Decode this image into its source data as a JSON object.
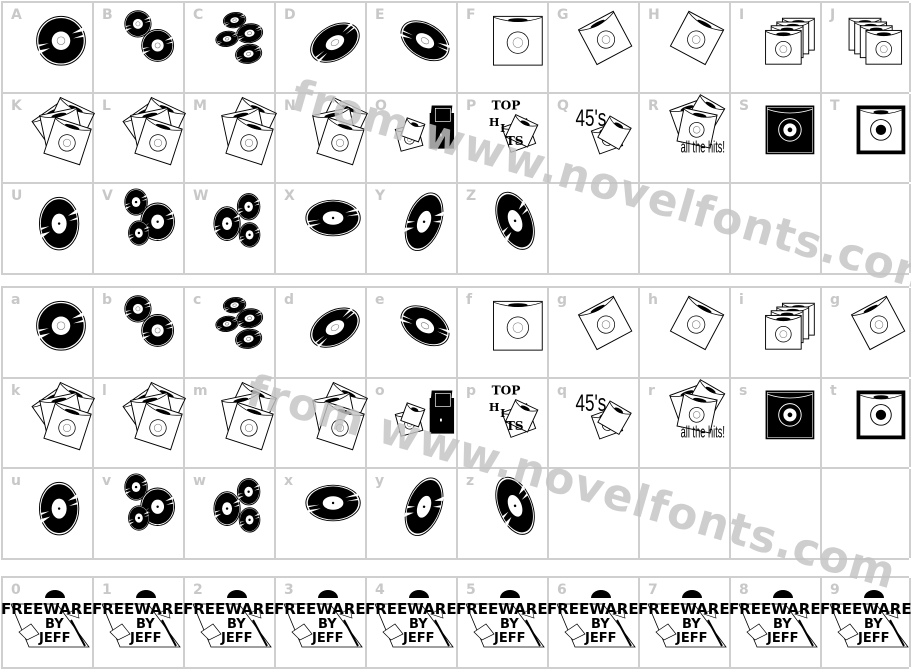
{
  "page": {
    "watermark_text": "from www.novelfonts.com"
  },
  "sections": [
    {
      "name": "uppercase",
      "rows": [
        [
          {
            "label": "A",
            "glyph": "record-round"
          },
          {
            "label": "B",
            "glyph": "two-records"
          },
          {
            "label": "C",
            "glyph": "four-records"
          },
          {
            "label": "D",
            "glyph": "record-tilt-right"
          },
          {
            "label": "E",
            "glyph": "record-tilt-left"
          },
          {
            "label": "F",
            "glyph": "sleeve-square"
          },
          {
            "label": "G",
            "glyph": "sleeve-rotated-left"
          },
          {
            "label": "H",
            "glyph": "sleeve-rotated-right"
          },
          {
            "label": "I",
            "glyph": "sleeve-stack-left"
          },
          {
            "label": "J",
            "glyph": "sleeve-stack-right"
          }
        ],
        [
          {
            "label": "K",
            "glyph": "sleeve-pile"
          },
          {
            "label": "L",
            "glyph": "sleeve-pile"
          },
          {
            "label": "M",
            "glyph": "sleeve-pile-two"
          },
          {
            "label": "N",
            "glyph": "sleeve-pile-two"
          },
          {
            "label": "O",
            "glyph": "record-box"
          },
          {
            "label": "P",
            "glyph": "top-hits"
          },
          {
            "label": "Q",
            "glyph": "45s"
          },
          {
            "label": "R",
            "glyph": "all-the-hits"
          },
          {
            "label": "S",
            "glyph": "framed-record-dark"
          },
          {
            "label": "T",
            "glyph": "framed-record-light"
          }
        ],
        [
          {
            "label": "U",
            "glyph": "record-oval-vertical"
          },
          {
            "label": "V",
            "glyph": "three-records-v"
          },
          {
            "label": "W",
            "glyph": "three-records-w"
          },
          {
            "label": "X",
            "glyph": "record-flat"
          },
          {
            "label": "Y",
            "glyph": "record-oval-tilt-right"
          },
          {
            "label": "Z",
            "glyph": "record-oval-tilt-left"
          },
          {
            "label": "",
            "glyph": ""
          },
          {
            "label": "",
            "glyph": ""
          },
          {
            "label": "",
            "glyph": ""
          },
          {
            "label": "",
            "glyph": ""
          }
        ]
      ]
    },
    {
      "name": "lowercase",
      "rows": [
        [
          {
            "label": "a",
            "glyph": "record-round"
          },
          {
            "label": "b",
            "glyph": "two-records"
          },
          {
            "label": "c",
            "glyph": "four-records"
          },
          {
            "label": "d",
            "glyph": "record-tilt-right"
          },
          {
            "label": "e",
            "glyph": "record-tilt-left"
          },
          {
            "label": "f",
            "glyph": "sleeve-square"
          },
          {
            "label": "g",
            "glyph": "sleeve-rotated-left"
          },
          {
            "label": "h",
            "glyph": "sleeve-rotated-right"
          },
          {
            "label": "i",
            "glyph": "sleeve-stack-left"
          },
          {
            "label": "g",
            "glyph": "sleeve-rotated-left"
          }
        ],
        [
          {
            "label": "k",
            "glyph": "sleeve-pile"
          },
          {
            "label": "l",
            "glyph": "sleeve-pile"
          },
          {
            "label": "m",
            "glyph": "sleeve-pile-two"
          },
          {
            "label": "",
            "glyph": "sleeve-pile-two"
          },
          {
            "label": "o",
            "glyph": "record-box"
          },
          {
            "label": "p",
            "glyph": "top-hits"
          },
          {
            "label": "q",
            "glyph": "45s"
          },
          {
            "label": "r",
            "glyph": "all-the-hits"
          },
          {
            "label": "s",
            "glyph": "framed-record-dark"
          },
          {
            "label": "t",
            "glyph": "framed-record-light"
          }
        ],
        [
          {
            "label": "u",
            "glyph": "record-oval-vertical"
          },
          {
            "label": "v",
            "glyph": "three-records-v"
          },
          {
            "label": "w",
            "glyph": "three-records-w"
          },
          {
            "label": "x",
            "glyph": "record-flat"
          },
          {
            "label": "y",
            "glyph": "record-oval-tilt-right"
          },
          {
            "label": "z",
            "glyph": "record-oval-tilt-left"
          },
          {
            "label": "",
            "glyph": ""
          },
          {
            "label": "",
            "glyph": ""
          },
          {
            "label": "",
            "glyph": ""
          },
          {
            "label": "",
            "glyph": ""
          }
        ]
      ]
    },
    {
      "name": "digits",
      "rows": [
        [
          {
            "label": "0",
            "glyph": "freeware-banner"
          },
          {
            "label": "1",
            "glyph": "freeware-banner"
          },
          {
            "label": "2",
            "glyph": "freeware-banner"
          },
          {
            "label": "3",
            "glyph": "freeware-banner"
          },
          {
            "label": "4",
            "glyph": "freeware-banner"
          },
          {
            "label": "5",
            "glyph": "freeware-banner"
          },
          {
            "label": "6",
            "glyph": "freeware-banner"
          },
          {
            "label": "7",
            "glyph": "freeware-banner"
          },
          {
            "label": "8",
            "glyph": "freeware-banner"
          },
          {
            "label": "9",
            "glyph": "freeware-banner"
          }
        ]
      ]
    }
  ],
  "glyph_text": {
    "top": "TOP",
    "hits": "HITS",
    "fortyfive": "45's",
    "all_the_hits": "all the hits!",
    "freeware_line1": "FREEWARE",
    "freeware_line2": "BY",
    "freeware_line3": "JEFF"
  },
  "colors": {
    "ink": "#000000",
    "grid": "#cfcfcf",
    "label": "#c8c8c8",
    "watermark": "#c4c4c4"
  }
}
